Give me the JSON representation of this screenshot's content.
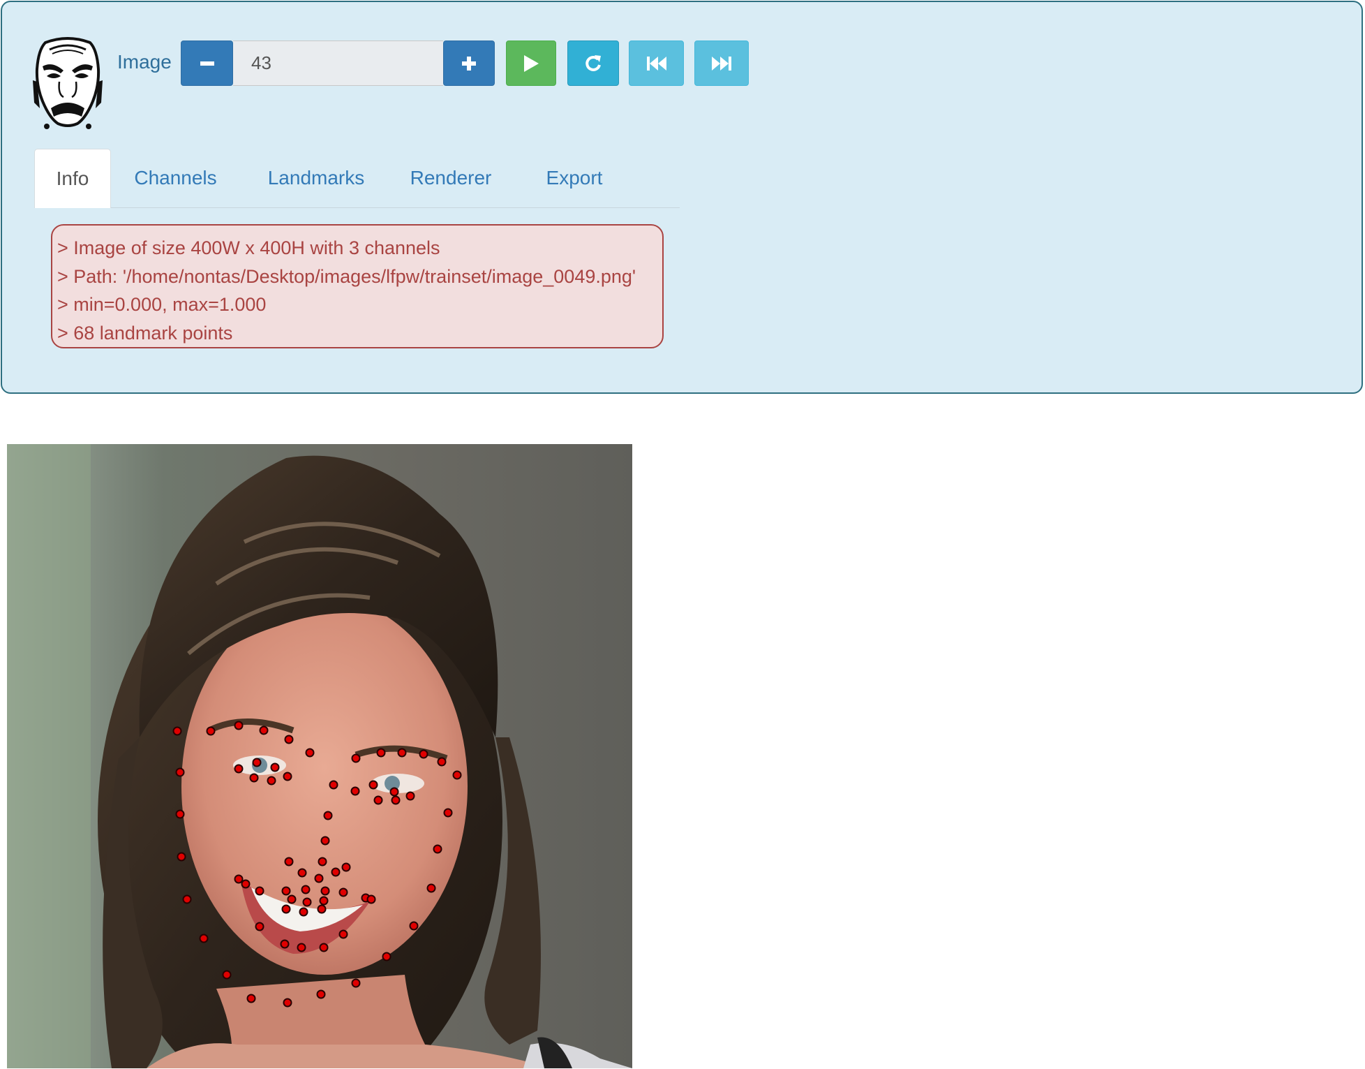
{
  "toolbar": {
    "image_label": "Image",
    "image_index": "43"
  },
  "tabs": [
    {
      "label": "Info",
      "active": true
    },
    {
      "label": "Channels",
      "active": false
    },
    {
      "label": "Landmarks",
      "active": false
    },
    {
      "label": "Renderer",
      "active": false
    },
    {
      "label": "Export",
      "active": false
    }
  ],
  "info": {
    "lines": [
      "> Image of size 400W x 400H with 3 channels",
      "> Path: '/home/nontas/Desktop/images/lfpw/trainset/image_0049.png'",
      "> min=0.000, max=1.000",
      "> 68 landmark points"
    ]
  },
  "icons": {
    "minus": "minus-icon",
    "plus": "plus-icon",
    "play": "play-icon",
    "reload": "refresh-icon",
    "first": "fast-backward-icon",
    "last": "fast-forward-icon",
    "logo": "face-mask-logo"
  },
  "colors": {
    "panel_bg": "#d9ecf5",
    "primary": "#337ab7",
    "success": "#5cb85c",
    "info": "#5bc0de",
    "danger_text": "#a94442",
    "danger_bg": "#f2dede",
    "landmark": "#e00000"
  }
}
